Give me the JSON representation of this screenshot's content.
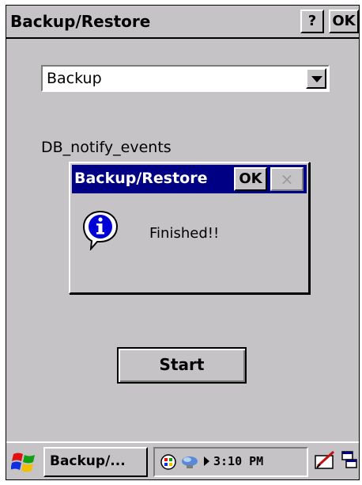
{
  "window": {
    "title": "Backup/Restore",
    "help_label": "?",
    "ok_label": "OK"
  },
  "combo": {
    "selected": "Backup"
  },
  "status": {
    "text": "DB_notify_events"
  },
  "dialog": {
    "title": "Backup/Restore",
    "ok_label": "OK",
    "close_label": "×",
    "message": "Finished!!",
    "icon": "info-icon"
  },
  "start_button": {
    "label": "Start"
  },
  "taskbar": {
    "task_label": "Backup/...",
    "clock": "3:10 PM",
    "icons": [
      "windows-start-icon",
      "network-icon",
      "connection-icon",
      "input-panel-icon",
      "desktop-icon"
    ]
  },
  "colors": {
    "face": "#c6c3c6",
    "dialog_title_bg": "#000084",
    "dialog_title_text": "#ffffff"
  }
}
